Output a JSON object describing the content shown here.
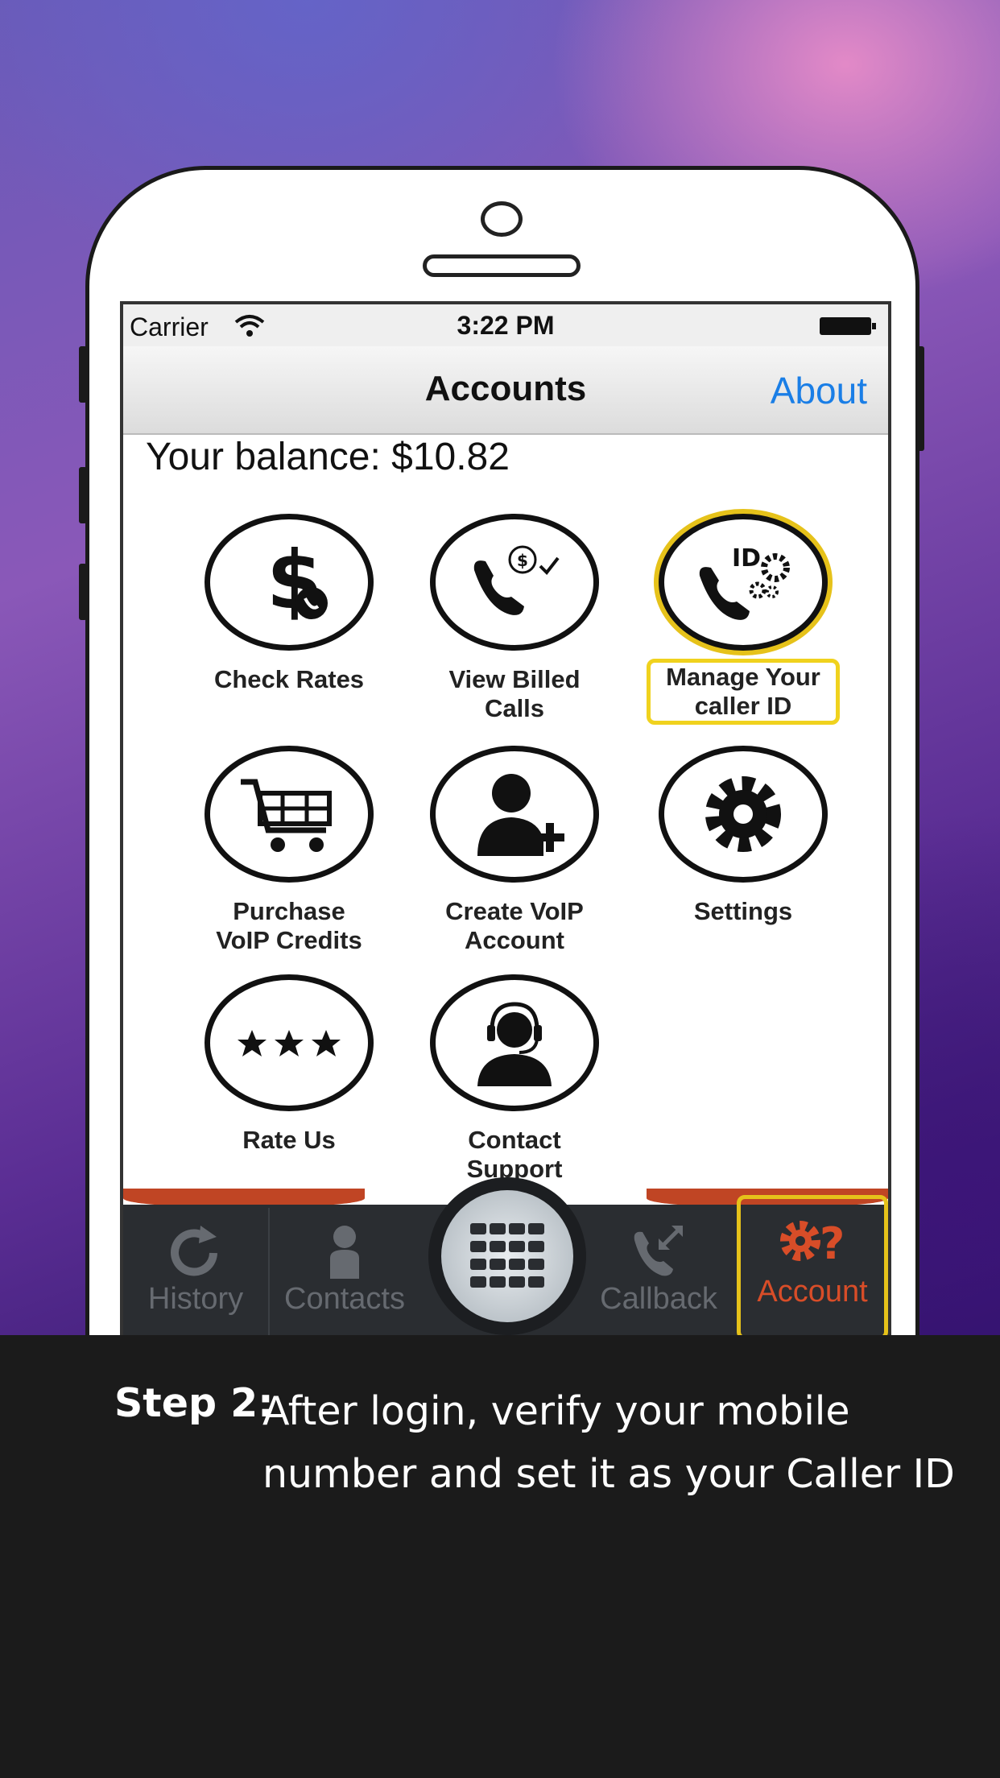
{
  "status_bar": {
    "carrier": "Carrier",
    "time": "3:22 PM"
  },
  "nav": {
    "title": "Accounts",
    "about": "About"
  },
  "balance": {
    "text": "Your balance: $10.82"
  },
  "tiles": [
    {
      "label": "Check Rates",
      "icon": "dollar-phone-icon"
    },
    {
      "label": "View Billed\nCalls",
      "icon": "phone-billing-icon"
    },
    {
      "label": "Manage Your\ncaller ID",
      "icon": "caller-id-settings-icon"
    },
    {
      "label": "Purchase\nVoIP Credits",
      "icon": "shopping-cart-icon"
    },
    {
      "label": "Create VoIP\nAccount",
      "icon": "add-user-icon"
    },
    {
      "label": "Settings",
      "icon": "gear-icon"
    },
    {
      "label": "Rate Us",
      "icon": "stars-icon"
    },
    {
      "label": "Contact\nSupport",
      "icon": "headset-support-icon"
    }
  ],
  "tabs": [
    {
      "label": "History",
      "icon": "refresh-icon"
    },
    {
      "label": "Contacts",
      "icon": "person-icon"
    },
    {
      "label": "Callback",
      "icon": "phone-callback-icon"
    },
    {
      "label": "Account",
      "icon": "gear-question-icon",
      "active": true
    }
  ],
  "caption": {
    "step": "Step 2:",
    "text": "After login, verify your mobile number and set it as your Caller ID"
  },
  "colors": {
    "accent": "#d84d28",
    "highlight": "#f0d21e",
    "link": "#1a7ee6"
  }
}
